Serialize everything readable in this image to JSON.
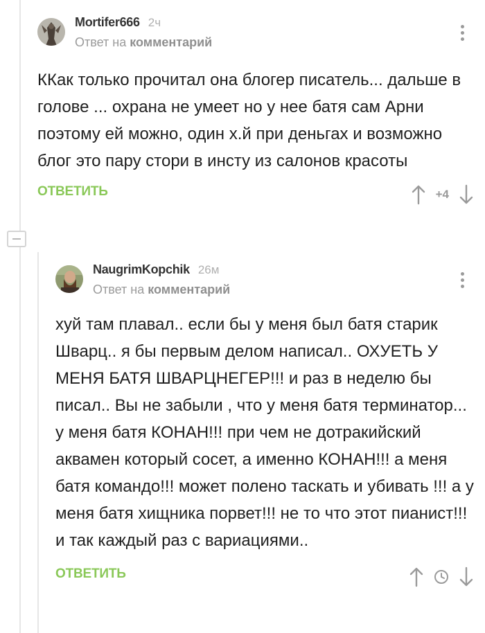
{
  "comments": [
    {
      "username": "Mortifer666",
      "time": "2ч",
      "reply_prefix": "Ответ на",
      "reply_link": "комментарий",
      "text": "ККак только прочитал она блогер писатель... дальше в голове ... охрана не умеет но у нее батя сам Арни поэтому ей можно, один х.й при деньгах и возможно блог это пару стори в инсту из салонов красоты",
      "reply_label": "ОТВЕТИТЬ",
      "rating": "+4"
    },
    {
      "username": "NaugrimKopchik",
      "time": "26м",
      "reply_prefix": "Ответ на",
      "reply_link": "комментарий",
      "text": "хуй там плавал.. если бы у меня был батя старик Шварц.. я бы первым делом написал.. ОХУЕТЬ У МЕНЯ БАТЯ ШВАРЦНЕГЕР!!! и раз в неделю бы  писал..  Вы не забыли , что у меня батя  терминатор... у меня батя КОНАН!!! при чем не дотракийский аквамен который сосет, а именно КОНАН!!! а меня батя командо!!! может полено таскать и убивать !!! а у меня батя хищника порвет!!! не то что этот пианист!!!  и так каждый раз с вариациями..",
      "reply_label": "ОТВЕТИТЬ"
    }
  ],
  "colors": {
    "accent": "#8ac858",
    "muted": "#9a9a9a",
    "text": "#1f1f1f"
  }
}
